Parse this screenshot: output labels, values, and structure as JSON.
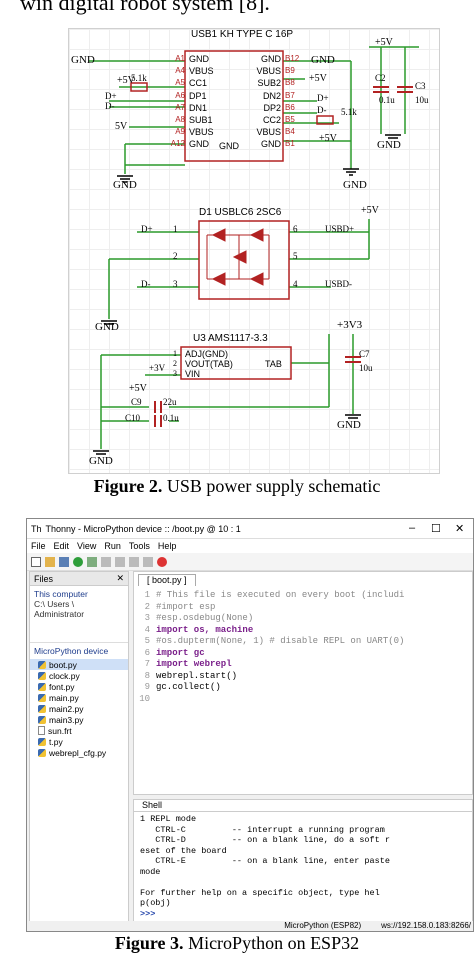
{
  "top_text": "win digital robot system [8].",
  "schematic": {
    "usb1": {
      "title": "USB1  KH TYPE C 16P",
      "left_pins": [
        {
          "num": "A1",
          "name": "GND"
        },
        {
          "num": "A4",
          "name": "VBUS"
        },
        {
          "num": "A5",
          "name": "CC1"
        },
        {
          "num": "A6",
          "name": "DP1"
        },
        {
          "num": "A7",
          "name": "DN1"
        },
        {
          "num": "A8",
          "name": "SUB1"
        },
        {
          "num": "A9",
          "name": "VBUS"
        },
        {
          "num": "A12",
          "name": "GND"
        }
      ],
      "right_pins": [
        {
          "num": "B12",
          "name": "GND"
        },
        {
          "num": "B9",
          "name": "VBUS"
        },
        {
          "num": "B8",
          "name": "SUB2"
        },
        {
          "num": "B7",
          "name": "DN2"
        },
        {
          "num": "B6",
          "name": "DP2"
        },
        {
          "num": "B5",
          "name": "CC2"
        },
        {
          "num": "B4",
          "name": "VBUS"
        },
        {
          "num": "B1",
          "name": "GND"
        }
      ],
      "bottom_label": "GND"
    },
    "labels": {
      "gnd": "GND",
      "p5v": "+5V",
      "p5v_alt": "5V",
      "r_left": "5.1k",
      "r_right": "5.1k",
      "c2": "C2",
      "c3": "C3",
      "c2_val": "0.1u",
      "c3_val": "10u",
      "d_plus": "D+",
      "d_minus": "D-"
    },
    "d1": {
      "title": "D1  USBLC6 2SC6",
      "pins_left": [
        "1",
        "2",
        "3"
      ],
      "pins_right": [
        "6",
        "5",
        "4"
      ],
      "left_labels": [
        "D+",
        "",
        "D-"
      ],
      "right_labels": [
        "USBD+",
        "",
        "USBD-"
      ]
    },
    "u3": {
      "title": "U3  AMS1117-3.3",
      "pins": [
        {
          "num": "1",
          "name": "ADJ(GND)"
        },
        {
          "num": "2",
          "name": "VOUT(TAB)"
        },
        {
          "num": "3",
          "name": "VIN"
        }
      ],
      "tab": "TAB",
      "p3v3": "+3V3",
      "p3v": "+3V",
      "c7": "C7",
      "c7_val": "10u",
      "c9": "C9",
      "c9_val": "22u",
      "c10": "C10",
      "c10_val": "0.1u"
    }
  },
  "figure2": {
    "label": "Figure 2.",
    "caption": "USB power supply schematic"
  },
  "thonny": {
    "title": "Thonny  -  MicroPython device :: /boot.py  @  10 : 1",
    "menus": [
      "File",
      "Edit",
      "View",
      "Run",
      "Tools",
      "Help"
    ],
    "files_header": "Files",
    "computer_section": "This computer",
    "computer_path": "C:\\ Users \\ Administrator",
    "device_section": "MicroPython device",
    "files": [
      {
        "name": "boot.py",
        "type": "py",
        "selected": true
      },
      {
        "name": "clock.py",
        "type": "py"
      },
      {
        "name": "font.py",
        "type": "py"
      },
      {
        "name": "main.py",
        "type": "py"
      },
      {
        "name": "main2.py",
        "type": "py"
      },
      {
        "name": "main3.py",
        "type": "py"
      },
      {
        "name": "sun.frt",
        "type": "doc"
      },
      {
        "name": "t.py",
        "type": "py"
      },
      {
        "name": "webrepl_cfg.py",
        "type": "py"
      }
    ],
    "editor_tab": "[ boot.py ]",
    "code": [
      {
        "n": "1",
        "t": "# This file is executed on every boot (includi",
        "k": "cm"
      },
      {
        "n": "2",
        "t": "#import esp",
        "k": "cm"
      },
      {
        "n": "3",
        "t": "#esp.osdebug(None)",
        "k": "cm"
      },
      {
        "n": "4",
        "t": "import os, machine",
        "k": "kw"
      },
      {
        "n": "5",
        "t": "#os.dupterm(None, 1) # disable REPL on UART(0)",
        "k": "cm"
      },
      {
        "n": "6",
        "t": "import gc",
        "k": "kw"
      },
      {
        "n": "7",
        "t": "import webrepl",
        "k": "kw"
      },
      {
        "n": "8",
        "t": "webrepl.start()",
        "k": ""
      },
      {
        "n": "9",
        "t": "gc.collect()",
        "k": ""
      },
      {
        "n": "10",
        "t": "",
        "k": ""
      }
    ],
    "shell_header": "Shell",
    "shell_lines": [
      "1 REPL mode",
      "   CTRL-C         -- interrupt a running program",
      "   CTRL-D         -- on a blank line, do a soft r",
      "eset of the board",
      "   CTRL-E         -- on a blank line, enter paste",
      "mode",
      "",
      "For further help on a specific object, type hel",
      "p(obj)"
    ],
    "prompt": ">>>",
    "status_device": "MicroPython (ESP82)",
    "status_addr": "ws://192.158.0.183:8266/"
  },
  "figure3": {
    "label": "Figure 3.",
    "caption": "MicroPython on ESP32"
  }
}
